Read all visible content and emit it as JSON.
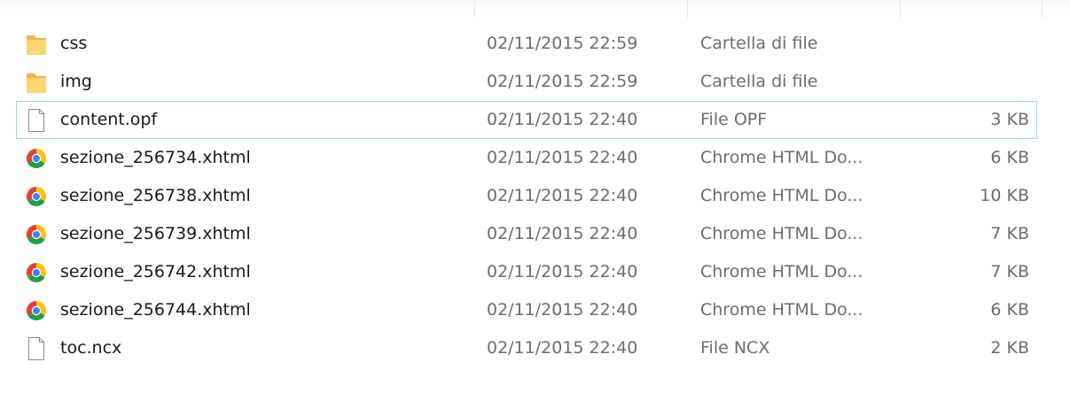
{
  "files": [
    {
      "name": "css",
      "date": "02/11/2015 22:59",
      "type": "Cartella di file",
      "size": "",
      "icon": "folder-icon"
    },
    {
      "name": "img",
      "date": "02/11/2015 22:59",
      "type": "Cartella di file",
      "size": "",
      "icon": "folder-icon"
    },
    {
      "name": "content.opf",
      "date": "02/11/2015 22:40",
      "type": "File OPF",
      "size": "3 KB",
      "icon": "document-icon",
      "selected": true
    },
    {
      "name": "sezione_256734.xhtml",
      "date": "02/11/2015 22:40",
      "type": "Chrome HTML Do...",
      "size": "6 KB",
      "icon": "chrome-icon"
    },
    {
      "name": "sezione_256738.xhtml",
      "date": "02/11/2015 22:40",
      "type": "Chrome HTML Do...",
      "size": "10 KB",
      "icon": "chrome-icon"
    },
    {
      "name": "sezione_256739.xhtml",
      "date": "02/11/2015 22:40",
      "type": "Chrome HTML Do...",
      "size": "7 KB",
      "icon": "chrome-icon"
    },
    {
      "name": "sezione_256742.xhtml",
      "date": "02/11/2015 22:40",
      "type": "Chrome HTML Do...",
      "size": "7 KB",
      "icon": "chrome-icon"
    },
    {
      "name": "sezione_256744.xhtml",
      "date": "02/11/2015 22:40",
      "type": "Chrome HTML Do...",
      "size": "6 KB",
      "icon": "chrome-icon"
    },
    {
      "name": "toc.ncx",
      "date": "02/11/2015 22:40",
      "type": "File NCX",
      "size": "2 KB",
      "icon": "document-icon"
    }
  ],
  "colors": {
    "selection_border": "#99d1ff",
    "secondary_text": "#6d6d6d",
    "folder": "#f8d775"
  }
}
